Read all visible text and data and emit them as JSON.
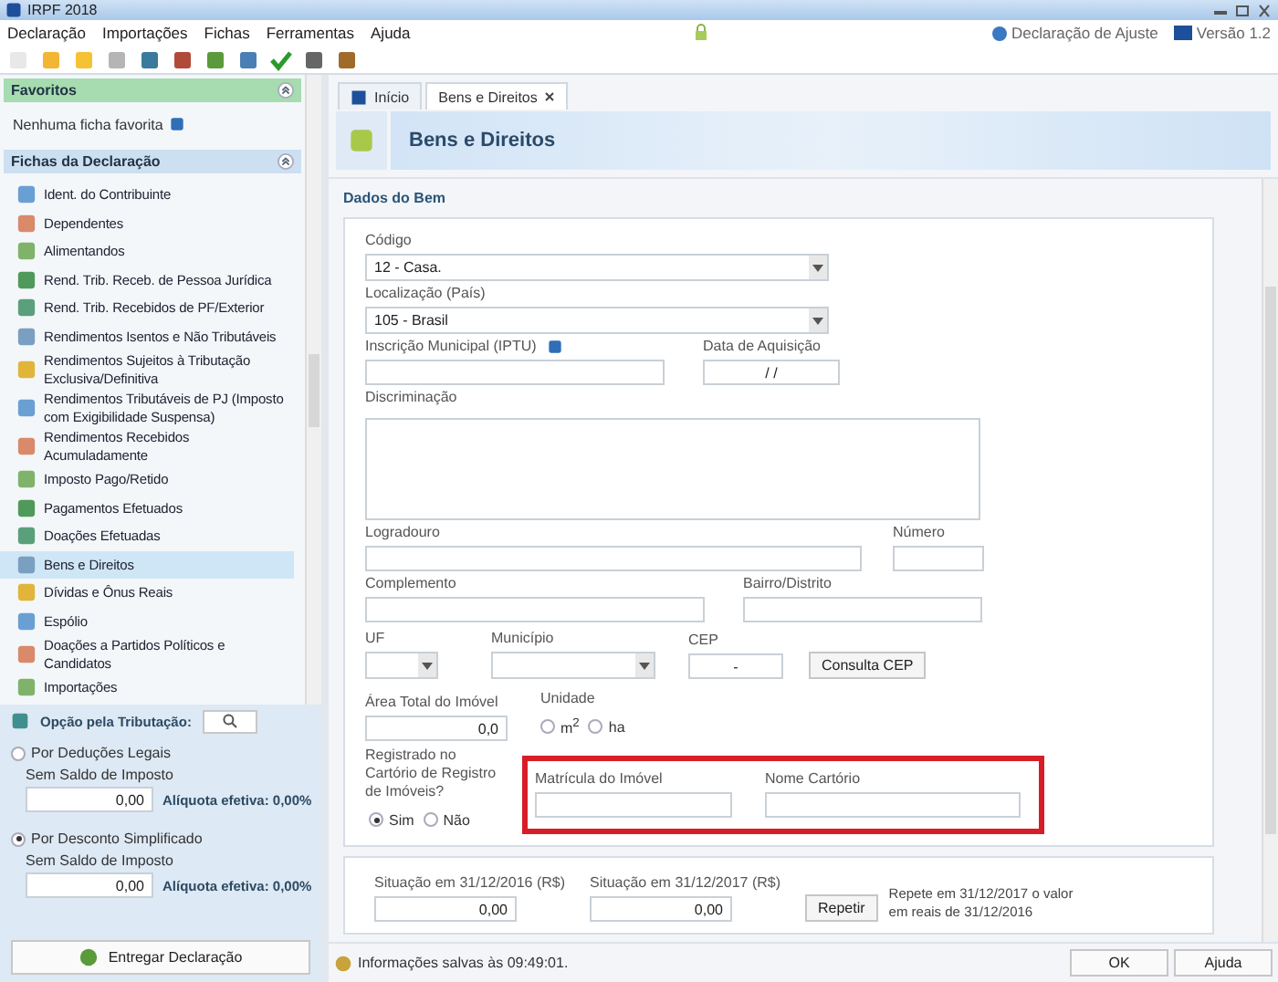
{
  "window": {
    "title": "IRPF 2018"
  },
  "menu": [
    "Declaração",
    "Importações",
    "Fichas",
    "Ferramentas",
    "Ajuda"
  ],
  "header_links": [
    {
      "kind": "ajuste",
      "label": "Declaração de Ajuste"
    },
    {
      "kind": "versao",
      "label": "Versão 1.2"
    }
  ],
  "favorites": {
    "title": "Favoritos",
    "empty_text": "Nenhuma ficha favorita"
  },
  "fichas": {
    "title": "Fichas da Declaração",
    "items": [
      {
        "label": "Ident. do Contribuinte",
        "selected": false
      },
      {
        "label": "Dependentes",
        "selected": false
      },
      {
        "label": "Alimentandos",
        "selected": false
      },
      {
        "label": "Rend. Trib. Receb. de Pessoa Jurídica",
        "selected": false
      },
      {
        "label": "Rend. Trib. Recebidos de PF/Exterior",
        "selected": false
      },
      {
        "label": "Rendimentos Isentos e Não Tributáveis",
        "selected": false
      },
      {
        "label": "Rendimentos Sujeitos à Tributação Exclusiva/Definitiva",
        "selected": false
      },
      {
        "label": "Rendimentos Tributáveis de PJ (Imposto com Exigibilidade Suspensa)",
        "selected": false
      },
      {
        "label": "Rendimentos Recebidos Acumuladamente",
        "selected": false
      },
      {
        "label": "Imposto Pago/Retido",
        "selected": false
      },
      {
        "label": "Pagamentos Efetuados",
        "selected": false
      },
      {
        "label": "Doações Efetuadas",
        "selected": false
      },
      {
        "label": "Bens e Direitos",
        "selected": true
      },
      {
        "label": "Dívidas e Ônus Reais",
        "selected": false
      },
      {
        "label": "Espólio",
        "selected": false
      },
      {
        "label": "Doações a Partidos Políticos e Candidatos",
        "selected": false
      },
      {
        "label": "Importações",
        "selected": false
      }
    ]
  },
  "tributacao": {
    "label": "Opção pela Tributação:",
    "options": [
      {
        "label": "Por Deduções Legais",
        "selected": false,
        "status": "Sem Saldo de Imposto",
        "value": "0,00",
        "aliquota": "Alíquota efetiva: 0,00%"
      },
      {
        "label": "Por Desconto Simplificado",
        "selected": true,
        "status": "Sem Saldo de Imposto",
        "value": "0,00",
        "aliquota": "Alíquota efetiva: 0,00%"
      }
    ],
    "submit": "Entregar Declaração"
  },
  "tabs": [
    {
      "label": "Início",
      "selected": false,
      "closable": false
    },
    {
      "label": "Bens e Direitos",
      "selected": true,
      "closable": true
    }
  ],
  "page_title": "Bens e Direitos",
  "section_title": "Dados do Bem",
  "form": {
    "codigo": {
      "label": "Código",
      "value": "12 - Casa."
    },
    "localizacao": {
      "label": "Localização (País)",
      "value": "105 - Brasil"
    },
    "inscricao": {
      "label": "Inscrição Municipal (IPTU)"
    },
    "data_aquisicao": {
      "label": "Data de Aquisição",
      "value": "/ /"
    },
    "discriminacao": {
      "label": "Discriminação"
    },
    "logradouro": {
      "label": "Logradouro"
    },
    "numero": {
      "label": "Número"
    },
    "complemento": {
      "label": "Complemento"
    },
    "bairro": {
      "label": "Bairro/Distrito"
    },
    "uf": {
      "label": "UF"
    },
    "municipio": {
      "label": "Município"
    },
    "cep": {
      "label": "CEP",
      "value": "-"
    },
    "consulta_cep": "Consulta CEP",
    "area": {
      "label": "Área Total do Imóvel",
      "value": "0,0"
    },
    "unidade": {
      "label": "Unidade",
      "options": [
        {
          "label": "m$^{2}$",
          "selected": false
        },
        {
          "label": "ha",
          "selected": false
        }
      ]
    },
    "registrado": {
      "label": "Registrado no Cartório de Registro de Imóveis?",
      "options": [
        {
          "label": "Sim",
          "selected": true
        },
        {
          "label": "Não",
          "selected": false
        }
      ]
    },
    "matricula": {
      "label": "Matrícula do Imóvel"
    },
    "nome_cartorio": {
      "label": "Nome Cartório"
    }
  },
  "situacao": {
    "fields": [
      {
        "label": "Situação em 31/12/2016 (R$)",
        "value": "0,00"
      },
      {
        "label": "Situação em 31/12/2017 (R$)",
        "value": "0,00"
      }
    ],
    "repeat_button": "Repetir",
    "note": "Repete em 31/12/2017 o valor em reais de 31/12/2016"
  },
  "status": "Informações salvas às 09:49:01.",
  "buttons": [
    "OK",
    "Ajuda"
  ]
}
